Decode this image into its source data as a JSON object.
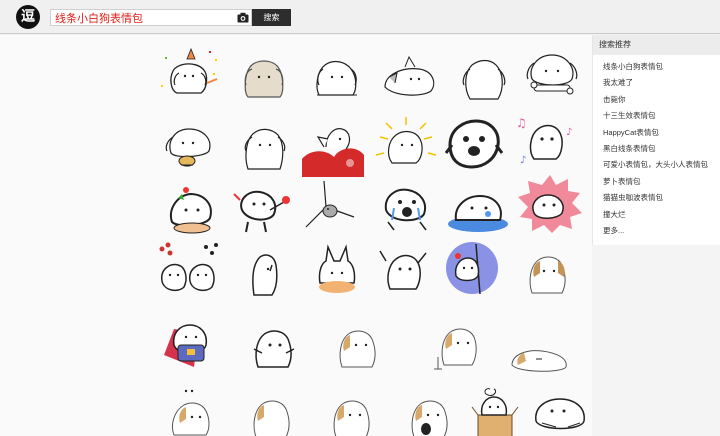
{
  "header": {
    "logo_glyph": "逗",
    "search_value": "线条小白狗表情包",
    "search_button_label": "搜索"
  },
  "sidebar": {
    "title": "搜索推荐",
    "items": [
      {
        "label": "线条小白狗表情包"
      },
      {
        "label": "我太难了"
      },
      {
        "label": "击毙你"
      },
      {
        "label": "十三生效表情包"
      },
      {
        "label": "HappyCat表情包"
      },
      {
        "label": "黑白线条表情包"
      },
      {
        "label": "可爱小表情包，大头小人表情包"
      },
      {
        "label": "萝卜表情包"
      },
      {
        "label": "猫猫虫咖波表情包"
      },
      {
        "label": "撞大烂"
      },
      {
        "label": "更多..."
      }
    ]
  },
  "results": {
    "stickers": [
      {
        "icon": "dog-party-icon"
      },
      {
        "icon": "dog-beige-icon"
      },
      {
        "icon": "dog-sitting-icon"
      },
      {
        "icon": "dog-lying-icon"
      },
      {
        "icon": "dog-back-icon"
      },
      {
        "icon": "dog-bone-icon"
      },
      {
        "icon": "dog-eating-icon"
      },
      {
        "icon": "dog-standing-icon"
      },
      {
        "icon": "dog-red-icon"
      },
      {
        "icon": "dog-shining-icon"
      },
      {
        "icon": "dog-shocked-icon"
      },
      {
        "icon": "dog-music-icon"
      },
      {
        "icon": "dog-flower-icon"
      },
      {
        "icon": "dog-gift-icon"
      },
      {
        "icon": "dog-corner-icon"
      },
      {
        "icon": "dog-crying-icon"
      },
      {
        "icon": "dog-puddle-icon"
      },
      {
        "icon": "dog-burst-icon"
      },
      {
        "icon": "dog-duo-icon"
      },
      {
        "icon": "dog-ghost-icon"
      },
      {
        "icon": "dog-bunny-icon"
      },
      {
        "icon": "dog-wave-icon"
      },
      {
        "icon": "dog-circle-icon"
      },
      {
        "icon": "dog-brown-ear-icon"
      },
      {
        "icon": "dog-hero-icon"
      },
      {
        "icon": "dog-hug-icon"
      },
      {
        "icon": "dog-tan-ear-icon"
      },
      {
        "icon": "dog-walk-icon"
      },
      {
        "icon": "dog-sleep-icon"
      },
      {
        "icon": "dog-dots-icon"
      },
      {
        "icon": "dog-back-tan-icon"
      },
      {
        "icon": "dog-small-tan-icon"
      },
      {
        "icon": "dog-black-hold-icon"
      },
      {
        "icon": "dog-box-icon"
      },
      {
        "icon": "dog-curl-icon"
      }
    ]
  }
}
